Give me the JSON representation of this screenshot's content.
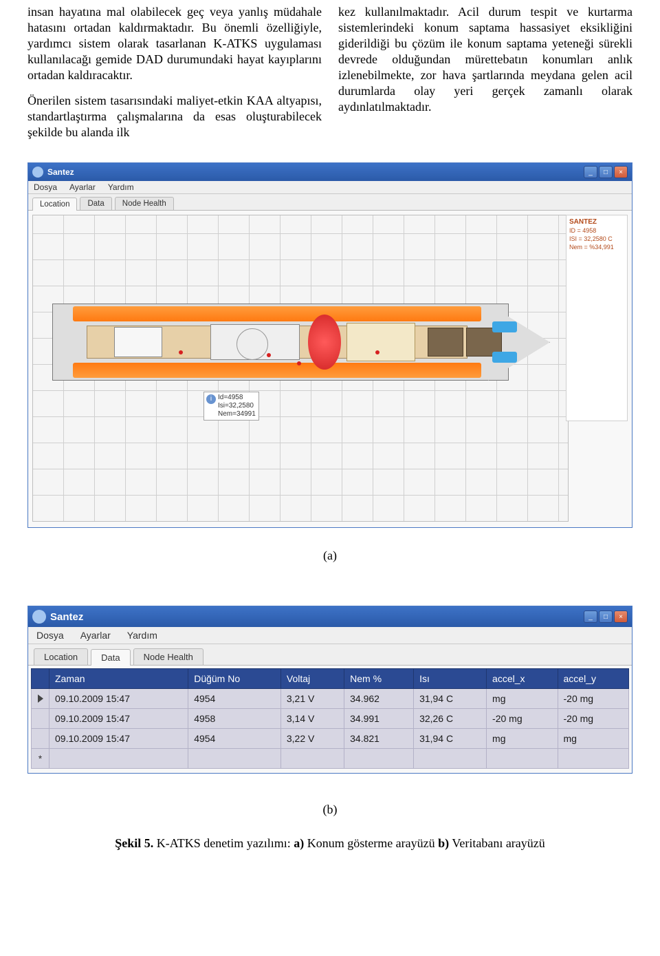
{
  "text": {
    "col1_p1": "insan hayatına mal olabilecek geç veya yanlış müdahale hatasını ortadan kaldırmaktadır. Bu önemli özelliğiyle, yardımcı sistem olarak tasarlanan K-ATKS uygulaması kullanılacağı gemide DAD durumundaki hayat kayıplarını ortadan kaldıracaktır.",
    "col1_p2": "Önerilen sistem tasarısındaki maliyet-etkin KAA altyapısı, standartlaştırma çalışmalarına da esas oluşturabilecek şekilde bu alanda ilk",
    "col2_p1": "kez kullanılmaktadır. Acil durum tespit ve kurtarma sistemlerindeki konum saptama hassasiyet eksikliğini giderildiği bu çözüm ile konum saptama yeteneği sürekli devrede olduğundan mürettebatın konumları anlık izlenebilmekte, zor hava şartlarında meydana gelen acil durumlarda olay yeri gerçek zamanlı olarak aydınlatılmaktadır."
  },
  "window_a": {
    "title": "Santez",
    "menu": [
      "Dosya",
      "Ayarlar",
      "Yardım"
    ],
    "tabs": [
      "Location",
      "Data",
      "Node Health"
    ],
    "active_tab": 0,
    "tooltip": {
      "line1": "Id=4958",
      "line2": "Isi=32,2580",
      "line3": "Nem=34991"
    },
    "sidepanel": {
      "title": "SANTEZ",
      "line1": "ID = 4958",
      "line2": "ISI = 32,2580 C",
      "line3": "Nem = %34,991"
    },
    "fig_label": "(a)"
  },
  "window_b": {
    "title": "Santez",
    "menu": [
      "Dosya",
      "Ayarlar",
      "Yardım"
    ],
    "tabs": [
      "Location",
      "Data",
      "Node Health"
    ],
    "active_tab": 1,
    "table": {
      "columns": [
        "Zaman",
        "Düğüm No",
        "Voltaj",
        "Nem %",
        "Isı",
        "accel_x",
        "accel_y"
      ],
      "rows": [
        [
          "09.10.2009 15:47",
          "4954",
          "3,21 V",
          "34.962",
          "31,94 C",
          "mg",
          "-20 mg"
        ],
        [
          "09.10.2009 15:47",
          "4958",
          "3,14 V",
          "34.991",
          "32,26 C",
          "-20 mg",
          "-20 mg"
        ],
        [
          "09.10.2009 15:47",
          "4954",
          "3,22 V",
          "34.821",
          "31,94 C",
          "mg",
          "mg"
        ]
      ]
    },
    "fig_label": "(b)"
  },
  "caption": {
    "lead": "Şekil 5.",
    "rest": " K-ATKS denetim yazılımı: ",
    "a": "a)",
    "a_txt": " Konum gösterme arayüzü ",
    "b": "b)",
    "b_txt": " Veritabanı arayüzü"
  }
}
